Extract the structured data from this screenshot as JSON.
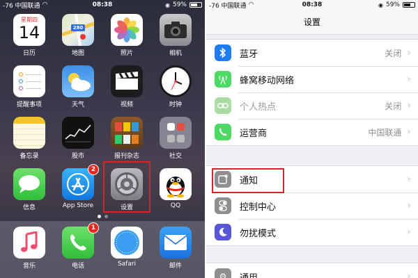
{
  "home": {
    "status": {
      "carrier": "-76 中国联通",
      "time": "08:38",
      "battery": "59%"
    },
    "calendar": {
      "weekday": "星期四",
      "day": "14"
    },
    "apps": [
      {
        "label": "日历",
        "icon": "calendar-icon"
      },
      {
        "label": "地图",
        "icon": "maps-icon",
        "sign": "280"
      },
      {
        "label": "照片",
        "icon": "photos-icon"
      },
      {
        "label": "相机",
        "icon": "camera-icon"
      },
      {
        "label": "提醒事项",
        "icon": "reminders-icon"
      },
      {
        "label": "天气",
        "icon": "weather-icon"
      },
      {
        "label": "视频",
        "icon": "videos-icon"
      },
      {
        "label": "时钟",
        "icon": "clock-icon"
      },
      {
        "label": "备忘录",
        "icon": "notes-icon"
      },
      {
        "label": "股市",
        "icon": "stocks-icon"
      },
      {
        "label": "报刊杂志",
        "icon": "newsstand-icon"
      },
      {
        "label": "社交",
        "icon": "social-folder-icon"
      },
      {
        "label": "信息",
        "icon": "messages-icon"
      },
      {
        "label": "App Store",
        "icon": "app-store-icon",
        "badge": "2"
      },
      {
        "label": "设置",
        "icon": "settings-gear-icon"
      },
      {
        "label": "QQ",
        "icon": "qq-icon"
      }
    ],
    "dock": [
      {
        "label": "音乐",
        "icon": "music-icon"
      },
      {
        "label": "电话",
        "icon": "phone-icon",
        "badge": "1"
      },
      {
        "label": "Safari",
        "icon": "safari-icon"
      },
      {
        "label": "邮件",
        "icon": "mail-icon"
      }
    ]
  },
  "settings": {
    "status": {
      "carrier": "-76 中国联通",
      "time": "08:38",
      "battery": "59%"
    },
    "title": "设置",
    "group1": [
      {
        "label": "蓝牙",
        "value": "关闭",
        "icon": "bluetooth-icon",
        "color": "#1e7cf0"
      },
      {
        "label": "蜂窝移动网络",
        "value": "",
        "icon": "cellular-icon",
        "color": "#4cd964"
      },
      {
        "label": "个人热点",
        "value": "关闭",
        "icon": "hotspot-icon",
        "color": "#a9dca5",
        "dim": true
      },
      {
        "label": "运营商",
        "value": "中国联通",
        "icon": "phone-icon",
        "color": "#4cd964"
      }
    ],
    "group2": [
      {
        "label": "通知",
        "value": "",
        "icon": "notifications-icon",
        "color": "#8e8e93"
      },
      {
        "label": "控制中心",
        "value": "",
        "icon": "control-center-icon",
        "color": "#8e8e93"
      },
      {
        "label": "勿扰模式",
        "value": "",
        "icon": "moon-icon",
        "color": "#5856d6"
      }
    ],
    "group3_partial": {
      "label": "通用",
      "icon": "gear-icon",
      "color": "#8e8e93"
    }
  },
  "colors": {
    "highlight": "#d8232a",
    "badge": "#e8281f"
  }
}
